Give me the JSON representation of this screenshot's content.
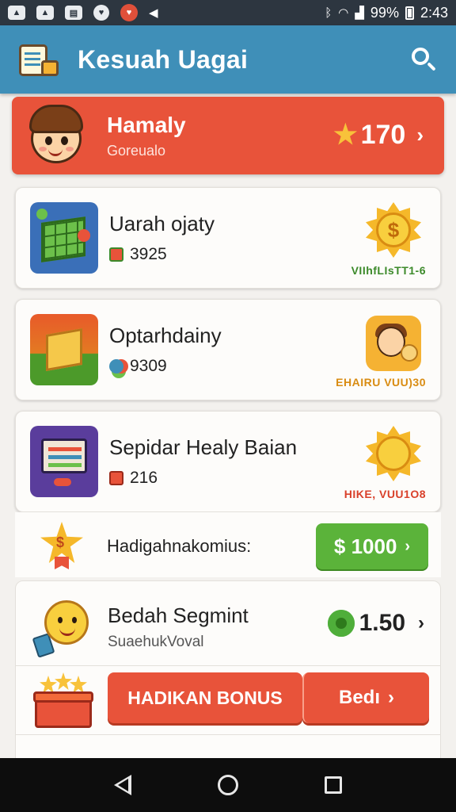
{
  "status_bar": {
    "battery": "99%",
    "time": "2:43",
    "left_icons": [
      "photo-icon",
      "photo-icon",
      "chat-icon",
      "location-icon",
      "app-icon",
      "send-icon"
    ]
  },
  "app_bar": {
    "title": "Kesuah Uagai",
    "logo_icon": "clipboard-icon",
    "search_icon": "search-icon"
  },
  "profile": {
    "name": "Hamaly",
    "subtitle": "Gorеualo",
    "points": "170",
    "points_icon": "star-icon"
  },
  "offers": [
    {
      "title": "Uarah ojaty",
      "value": "3925",
      "caption": "VIIhfLIsTT1-6",
      "badge": "$",
      "caption_color": "#3c8a2a"
    },
    {
      "title": "Optarhdainy",
      "value": "9309",
      "caption": "EHAIRU VUU)30",
      "badge": "",
      "caption_color": "#d98c12"
    },
    {
      "title": "Sepidar Healy Baian",
      "value": "216",
      "caption": "HIKE, VUU1O8",
      "badge": "",
      "caption_color": "#d9402a"
    }
  ],
  "bonus_row": {
    "label": "Hadigahnakomius:",
    "button_label": "$ 1000",
    "star_glyph": "$"
  },
  "segment": {
    "title": "Bedah Segmint",
    "subtitle": "SuaehukVoval",
    "reward": "1.50"
  },
  "actions": {
    "bonus_button": "HADIKAN BONUS",
    "next_button": "Bedı"
  },
  "colors": {
    "app_bar": "#3f8fb8",
    "accent_red": "#e8533a",
    "accent_green": "#5bb33a"
  }
}
